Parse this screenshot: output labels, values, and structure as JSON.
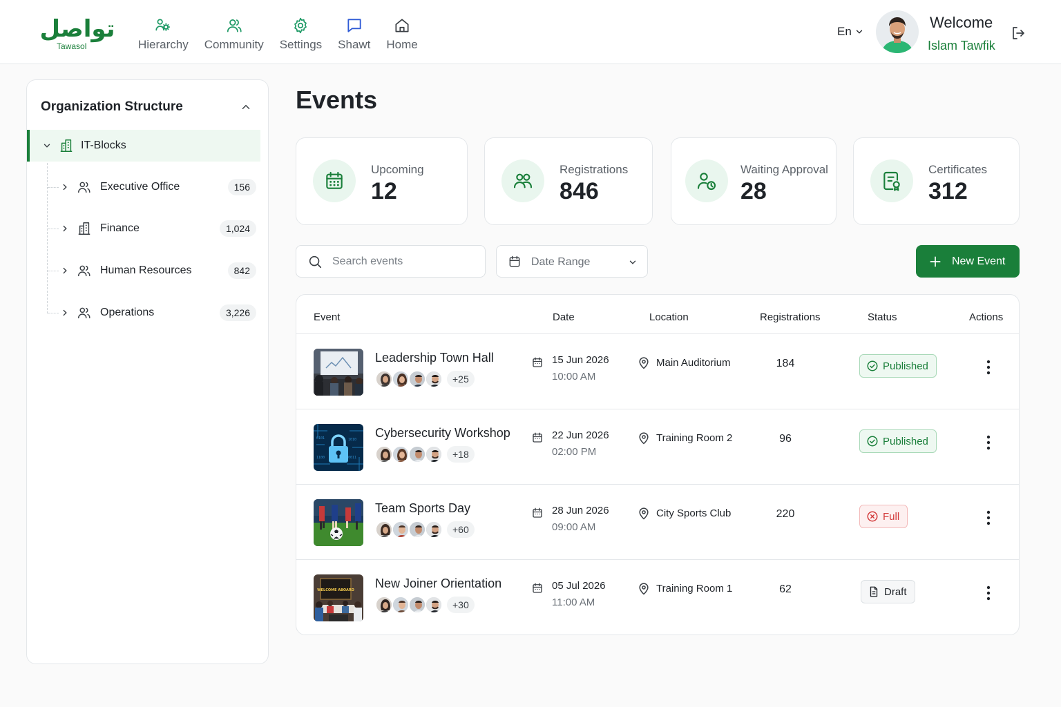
{
  "brand": {
    "logo_ar": "تواصل",
    "logo_en": "Tawasol",
    "accent": "#1a7f3a"
  },
  "nav": [
    {
      "label": "Hierarchy",
      "icon": "hierarchy-icon"
    },
    {
      "label": "Community",
      "icon": "community-icon"
    },
    {
      "label": "Settings",
      "icon": "gear-icon"
    },
    {
      "label": "Shawt",
      "icon": "chat-icon"
    },
    {
      "label": "Home",
      "icon": "home-icon"
    }
  ],
  "header": {
    "language": "En",
    "welcome": "Welcome",
    "user_name": "Islam Tawfik"
  },
  "sidebar": {
    "title": "Organization Structure",
    "root": {
      "label": "IT-Blocks"
    },
    "items": [
      {
        "label": "Executive Office",
        "count": "156",
        "icon": "users-icon"
      },
      {
        "label": "Finance",
        "count": "1,024",
        "icon": "building-icon"
      },
      {
        "label": "Human Resources",
        "count": "842",
        "icon": "users-icon"
      },
      {
        "label": "Operations",
        "count": "3,226",
        "icon": "users-icon"
      }
    ]
  },
  "page": {
    "title": "Events"
  },
  "stats": [
    {
      "label": "Upcoming",
      "value": "12",
      "icon": "calendar-icon"
    },
    {
      "label": "Registrations",
      "value": "846",
      "icon": "users-icon"
    },
    {
      "label": "Waiting Approval",
      "value": "28",
      "icon": "user-clock-icon"
    },
    {
      "label": "Certificates",
      "value": "312",
      "icon": "certificate-icon"
    }
  ],
  "toolbar": {
    "search_placeholder": "Search events",
    "date_range": "Date Range",
    "new_event": "New Event"
  },
  "table": {
    "headers": {
      "event": "Event",
      "date": "Date",
      "location": "Location",
      "registrations": "Registrations",
      "status": "Status",
      "actions": "Actions"
    },
    "rows": [
      {
        "name": "Leadership Town Hall",
        "more": "+25",
        "date": "15 Jun 2026",
        "time": "10:00 AM",
        "location": "Main Auditorium",
        "registrations": "184",
        "status": "Published"
      },
      {
        "name": "Cybersecurity Workshop",
        "more": "+18",
        "date": "22 Jun 2026",
        "time": "02:00 PM",
        "location": "Training Room 2",
        "registrations": "96",
        "status": "Published"
      },
      {
        "name": "Team Sports Day",
        "more": "+60",
        "date": "28 Jun 2026",
        "time": "09:00 AM",
        "location": "City Sports Club",
        "registrations": "220",
        "status": "Full"
      },
      {
        "name": "New Joiner Orientation",
        "more": "+30",
        "date": "05 Jul 2026",
        "time": "11:00 AM",
        "location": "Training Room 1",
        "registrations": "62",
        "status": "Draft"
      }
    ]
  },
  "thumb_text": {
    "welcome_board": "WELCOME ABOARD"
  }
}
